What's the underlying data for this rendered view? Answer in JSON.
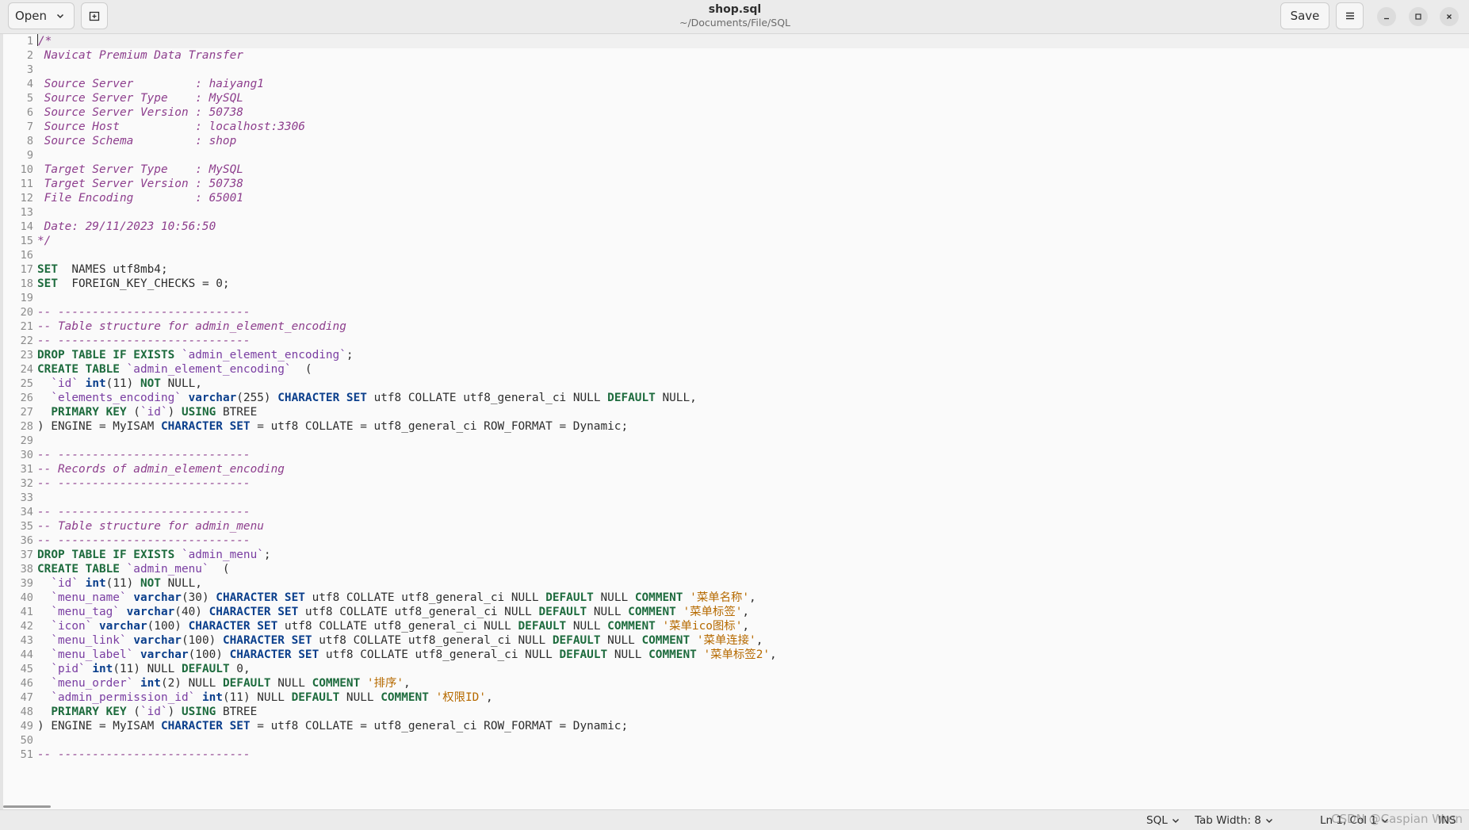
{
  "header": {
    "open_label": "Open",
    "save_label": "Save",
    "title": "shop.sql",
    "subtitle": "~/Documents/File/SQL"
  },
  "editor": {
    "lines": [
      [
        [
          "c",
          "/*"
        ]
      ],
      [
        [
          "c",
          " Navicat Premium Data Transfer"
        ]
      ],
      [],
      [
        [
          "c",
          " Source Server         : haiyang1"
        ]
      ],
      [
        [
          "c",
          " Source Server Type    : MySQL"
        ]
      ],
      [
        [
          "c",
          " Source Server Version : 50738"
        ]
      ],
      [
        [
          "c",
          " Source Host           : localhost:3306"
        ]
      ],
      [
        [
          "c",
          " Source Schema         : shop"
        ]
      ],
      [],
      [
        [
          "c",
          " Target Server Type    : MySQL"
        ]
      ],
      [
        [
          "c",
          " Target Server Version : 50738"
        ]
      ],
      [
        [
          "c",
          " File Encoding         : 65001"
        ]
      ],
      [],
      [
        [
          "c",
          " Date: 29/11/2023 10:56:50"
        ]
      ],
      [
        [
          "c",
          "*/"
        ]
      ],
      [],
      [
        [
          "k",
          "SET"
        ],
        [
          "",
          "  NAMES utf8mb4;"
        ]
      ],
      [
        [
          "k",
          "SET"
        ],
        [
          "",
          "  FOREIGN_KEY_CHECKS = 0;"
        ]
      ],
      [],
      [
        [
          "c",
          "-- ----------------------------"
        ]
      ],
      [
        [
          "c",
          "-- Table structure for admin_element_encoding"
        ]
      ],
      [
        [
          "c",
          "-- ----------------------------"
        ]
      ],
      [
        [
          "k",
          "DROP TABLE IF EXISTS"
        ],
        [
          "",
          " "
        ],
        [
          "q",
          "`admin_element_encoding`"
        ],
        [
          "",
          ";"
        ]
      ],
      [
        [
          "k",
          "CREATE TABLE"
        ],
        [
          "",
          " "
        ],
        [
          "q",
          "`admin_element_encoding`"
        ],
        [
          "",
          "  ("
        ]
      ],
      [
        [
          "",
          "  "
        ],
        [
          "q",
          "`id`"
        ],
        [
          "",
          " "
        ],
        [
          "t",
          "int"
        ],
        [
          "",
          "(11) "
        ],
        [
          "k",
          "NOT"
        ],
        [
          "",
          " NULL,"
        ]
      ],
      [
        [
          "",
          "  "
        ],
        [
          "q",
          "`elements_encoding`"
        ],
        [
          "",
          " "
        ],
        [
          "t",
          "varchar"
        ],
        [
          "",
          "(255) "
        ],
        [
          "t",
          "CHARACTER SET"
        ],
        [
          "",
          " utf8 COLLATE utf8_general_ci NULL "
        ],
        [
          "k",
          "DEFAULT"
        ],
        [
          "",
          " NULL,"
        ]
      ],
      [
        [
          "",
          "  "
        ],
        [
          "k",
          "PRIMARY KEY"
        ],
        [
          "",
          " ("
        ],
        [
          "q",
          "`id`"
        ],
        [
          "",
          ") "
        ],
        [
          "k",
          "USING"
        ],
        [
          "",
          " BTREE"
        ]
      ],
      [
        [
          "",
          ") ENGINE = MyISAM "
        ],
        [
          "t",
          "CHARACTER SET"
        ],
        [
          "",
          " = utf8 COLLATE = utf8_general_ci ROW_FORMAT = Dynamic;"
        ]
      ],
      [],
      [
        [
          "c",
          "-- ----------------------------"
        ]
      ],
      [
        [
          "c",
          "-- Records of admin_element_encoding"
        ]
      ],
      [
        [
          "c",
          "-- ----------------------------"
        ]
      ],
      [],
      [
        [
          "c",
          "-- ----------------------------"
        ]
      ],
      [
        [
          "c",
          "-- Table structure for admin_menu"
        ]
      ],
      [
        [
          "c",
          "-- ----------------------------"
        ]
      ],
      [
        [
          "k",
          "DROP TABLE IF EXISTS"
        ],
        [
          "",
          " "
        ],
        [
          "q",
          "`admin_menu`"
        ],
        [
          "",
          ";"
        ]
      ],
      [
        [
          "k",
          "CREATE TABLE"
        ],
        [
          "",
          " "
        ],
        [
          "q",
          "`admin_menu`"
        ],
        [
          "",
          "  ("
        ]
      ],
      [
        [
          "",
          "  "
        ],
        [
          "q",
          "`id`"
        ],
        [
          "",
          " "
        ],
        [
          "t",
          "int"
        ],
        [
          "",
          "(11) "
        ],
        [
          "k",
          "NOT"
        ],
        [
          "",
          " NULL,"
        ]
      ],
      [
        [
          "",
          "  "
        ],
        [
          "q",
          "`menu_name`"
        ],
        [
          "",
          " "
        ],
        [
          "t",
          "varchar"
        ],
        [
          "",
          "(30) "
        ],
        [
          "t",
          "CHARACTER SET"
        ],
        [
          "",
          " utf8 COLLATE utf8_general_ci NULL "
        ],
        [
          "k",
          "DEFAULT"
        ],
        [
          "",
          " NULL "
        ],
        [
          "k",
          "COMMENT"
        ],
        [
          "",
          " "
        ],
        [
          "s",
          "'菜单名称'"
        ],
        [
          "",
          ","
        ]
      ],
      [
        [
          "",
          "  "
        ],
        [
          "q",
          "`menu_tag`"
        ],
        [
          "",
          " "
        ],
        [
          "t",
          "varchar"
        ],
        [
          "",
          "(40) "
        ],
        [
          "t",
          "CHARACTER SET"
        ],
        [
          "",
          " utf8 COLLATE utf8_general_ci NULL "
        ],
        [
          "k",
          "DEFAULT"
        ],
        [
          "",
          " NULL "
        ],
        [
          "k",
          "COMMENT"
        ],
        [
          "",
          " "
        ],
        [
          "s",
          "'菜单标签'"
        ],
        [
          "",
          ","
        ]
      ],
      [
        [
          "",
          "  "
        ],
        [
          "q",
          "`icon`"
        ],
        [
          "",
          " "
        ],
        [
          "t",
          "varchar"
        ],
        [
          "",
          "(100) "
        ],
        [
          "t",
          "CHARACTER SET"
        ],
        [
          "",
          " utf8 COLLATE utf8_general_ci NULL "
        ],
        [
          "k",
          "DEFAULT"
        ],
        [
          "",
          " NULL "
        ],
        [
          "k",
          "COMMENT"
        ],
        [
          "",
          " "
        ],
        [
          "s",
          "'菜单ico图标'"
        ],
        [
          "",
          ","
        ]
      ],
      [
        [
          "",
          "  "
        ],
        [
          "q",
          "`menu_link`"
        ],
        [
          "",
          " "
        ],
        [
          "t",
          "varchar"
        ],
        [
          "",
          "(100) "
        ],
        [
          "t",
          "CHARACTER SET"
        ],
        [
          "",
          " utf8 COLLATE utf8_general_ci NULL "
        ],
        [
          "k",
          "DEFAULT"
        ],
        [
          "",
          " NULL "
        ],
        [
          "k",
          "COMMENT"
        ],
        [
          "",
          " "
        ],
        [
          "s",
          "'菜单连接'"
        ],
        [
          "",
          ","
        ]
      ],
      [
        [
          "",
          "  "
        ],
        [
          "q",
          "`menu_label`"
        ],
        [
          "",
          " "
        ],
        [
          "t",
          "varchar"
        ],
        [
          "",
          "(100) "
        ],
        [
          "t",
          "CHARACTER SET"
        ],
        [
          "",
          " utf8 COLLATE utf8_general_ci NULL "
        ],
        [
          "k",
          "DEFAULT"
        ],
        [
          "",
          " NULL "
        ],
        [
          "k",
          "COMMENT"
        ],
        [
          "",
          " "
        ],
        [
          "s",
          "'菜单标签2'"
        ],
        [
          "",
          ","
        ]
      ],
      [
        [
          "",
          "  "
        ],
        [
          "q",
          "`pid`"
        ],
        [
          "",
          " "
        ],
        [
          "t",
          "int"
        ],
        [
          "",
          "(11) NULL "
        ],
        [
          "k",
          "DEFAULT"
        ],
        [
          "",
          " 0,"
        ]
      ],
      [
        [
          "",
          "  "
        ],
        [
          "q",
          "`menu_order`"
        ],
        [
          "",
          " "
        ],
        [
          "t",
          "int"
        ],
        [
          "",
          "(2) NULL "
        ],
        [
          "k",
          "DEFAULT"
        ],
        [
          "",
          " NULL "
        ],
        [
          "k",
          "COMMENT"
        ],
        [
          "",
          " "
        ],
        [
          "s",
          "'排序'"
        ],
        [
          "",
          ","
        ]
      ],
      [
        [
          "",
          "  "
        ],
        [
          "q",
          "`admin_permission_id`"
        ],
        [
          "",
          " "
        ],
        [
          "t",
          "int"
        ],
        [
          "",
          "(11) NULL "
        ],
        [
          "k",
          "DEFAULT"
        ],
        [
          "",
          " NULL "
        ],
        [
          "k",
          "COMMENT"
        ],
        [
          "",
          " "
        ],
        [
          "s",
          "'权限ID'"
        ],
        [
          "",
          ","
        ]
      ],
      [
        [
          "",
          "  "
        ],
        [
          "k",
          "PRIMARY KEY"
        ],
        [
          "",
          " ("
        ],
        [
          "q",
          "`id`"
        ],
        [
          "",
          ") "
        ],
        [
          "k",
          "USING"
        ],
        [
          "",
          " BTREE"
        ]
      ],
      [
        [
          "",
          ") ENGINE = MyISAM "
        ],
        [
          "t",
          "CHARACTER SET"
        ],
        [
          "",
          " = utf8 COLLATE = utf8_general_ci ROW_FORMAT = Dynamic;"
        ]
      ],
      [],
      [
        [
          "c",
          "-- ----------------------------"
        ]
      ]
    ]
  },
  "statusbar": {
    "language": "SQL",
    "tab_width": "Tab Width: 8",
    "position": "Ln 1, Col 1",
    "mode": "INS",
    "watermark": "CSDN @Caspian Wren"
  },
  "icons": {
    "open_dropdown": "chevron-down-icon",
    "new_tab": "new-tab-icon",
    "menu": "hamburger-menu-icon",
    "minimize": "minimize-icon",
    "maximize": "maximize-icon",
    "close": "close-icon"
  }
}
